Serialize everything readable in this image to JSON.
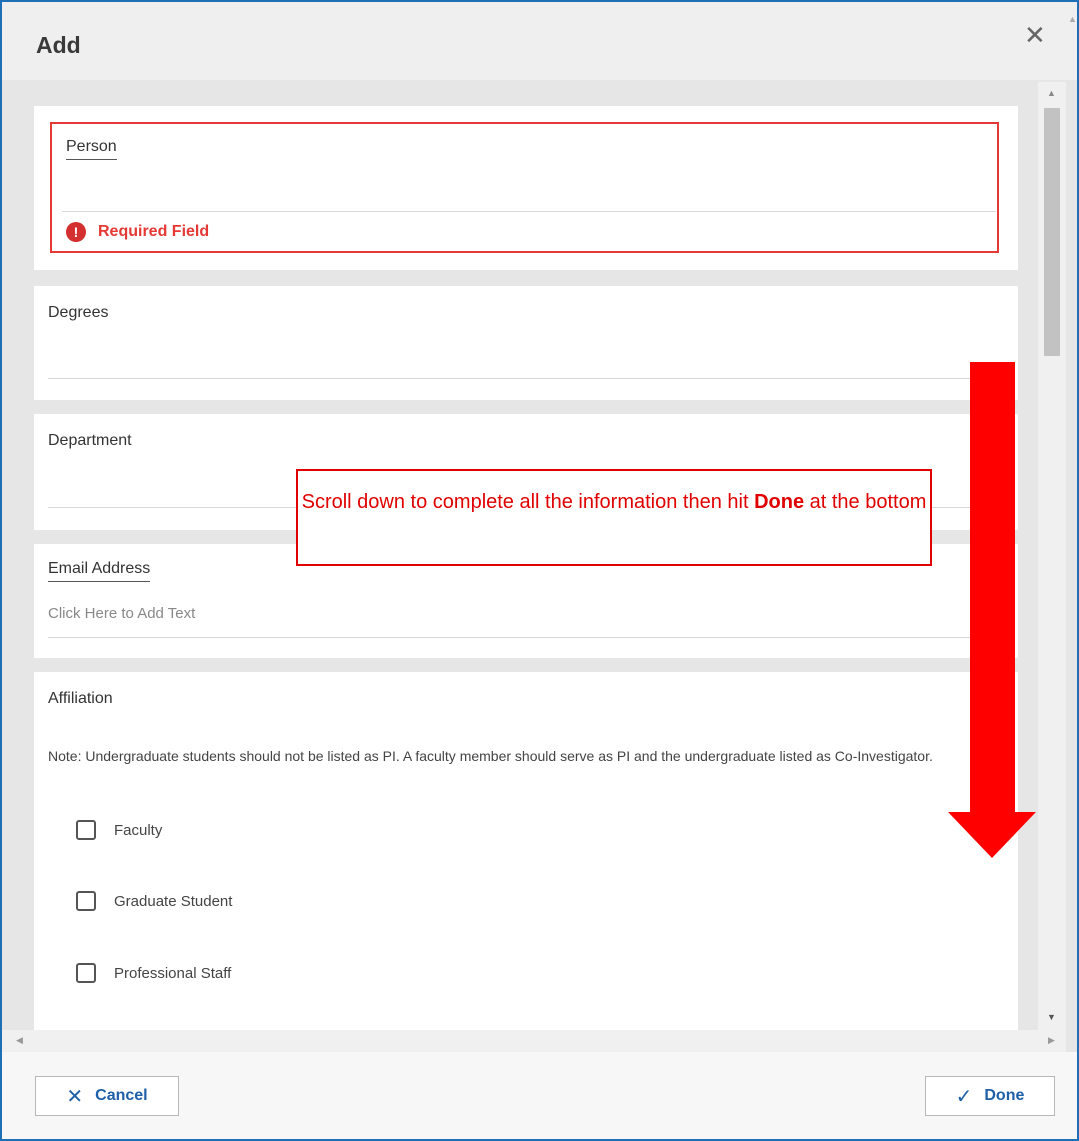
{
  "dialog": {
    "title": "Add",
    "close_icon": "close-icon"
  },
  "fields": {
    "person": {
      "label": "Person",
      "error": "Required Field",
      "error_icon": "exclamation-circle-icon"
    },
    "degrees": {
      "label": "Degrees"
    },
    "department": {
      "label": "Department"
    },
    "email": {
      "label": "Email Address",
      "placeholder": "Click Here to Add Text"
    },
    "affiliation": {
      "label": "Affiliation",
      "note": "Note: Undergraduate students should not be listed as PI. A faculty member should serve as PI and the undergraduate listed as Co-Investigator.",
      "options": [
        "Faculty",
        "Graduate Student",
        "Professional Staff"
      ]
    }
  },
  "annotation": {
    "text_before": "Scroll down to complete all the information then hit ",
    "bold": "Done",
    "text_after": " at the bottom",
    "color": "#e00000"
  },
  "footer": {
    "cancel_label": "Cancel",
    "cancel_icon": "close-icon",
    "done_label": "Done",
    "done_icon": "checkmark-icon"
  },
  "colors": {
    "accent": "#1f5fa8",
    "frame": "#1f6fb6",
    "error": "#e53935"
  }
}
